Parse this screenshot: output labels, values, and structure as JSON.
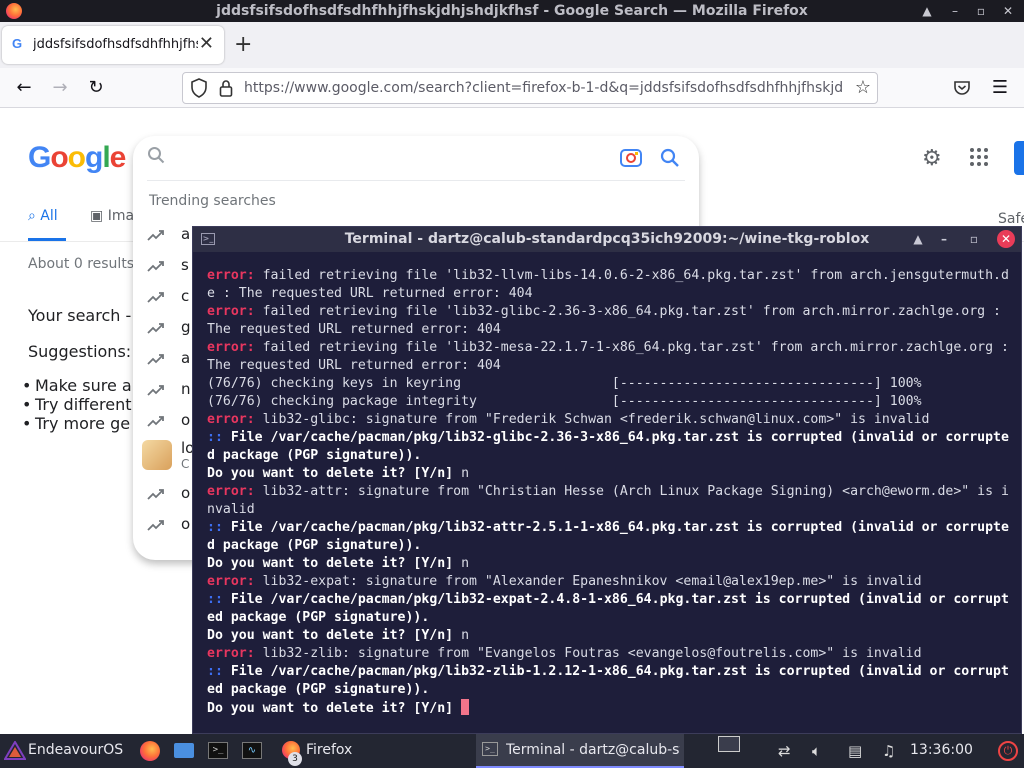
{
  "firefox": {
    "window_title": "jddsfsifsdofhsdfsdhfhhjfhskjdhjshdjkfhsf - Google Search — Mozilla Firefox",
    "tab_title": "jddsfsifsdofhsdfsdhfhhjfhskjdhjshdjkfhsf",
    "url": "https://www.google.com/search?client=firefox-b-1-d&q=jddsfsifsdofhsdfsdhfhhjfhskjdhjshdjkfhsf",
    "tab_close": "✕",
    "new_tab": "+"
  },
  "google": {
    "logo_letters": [
      "G",
      "o",
      "o",
      "g",
      "l",
      "e"
    ],
    "tabs": {
      "all": "All",
      "images": "Ima"
    },
    "safe_search": "Safe",
    "results_count": "About 0 results (0",
    "your_search": "Your search - jo",
    "suggestions_title": "Suggestions:",
    "suggestions": [
      "Make sure a",
      "Try different",
      "Try more ge"
    ],
    "dropdown": {
      "trending_label": "Trending searches",
      "items": [
        "a",
        "s",
        "c",
        "g",
        "a",
        "n",
        "o"
      ],
      "thumb_item": {
        "title": "lo",
        "subtitle": "C"
      },
      "items_after": [
        "o",
        "o"
      ]
    }
  },
  "terminal": {
    "title": "Terminal - dartz@calub-standardpcq35ich92009:~/wine-tkg-roblox",
    "lines": [
      [
        [
          "err",
          "error:"
        ],
        [
          "txt",
          " failed retrieving file 'lib32-llvm-libs-14.0.6-2-x86_64.pkg.tar.zst' from arch.jensgutermuth.de : The requested URL returned error: 404"
        ]
      ],
      [
        [
          "err",
          "error:"
        ],
        [
          "txt",
          " failed retrieving file 'lib32-glibc-2.36-3-x86_64.pkg.tar.zst' from arch.mirror.zachlge.org : The requested URL returned error: 404"
        ]
      ],
      [
        [
          "err",
          "error:"
        ],
        [
          "txt",
          " failed retrieving file 'lib32-mesa-22.1.7-1-x86_64.pkg.tar.zst' from arch.mirror.zachlge.org : The requested URL returned error: 404"
        ]
      ],
      [
        [
          "txt",
          "(76/76) checking keys in keyring                   [--------------------------------] 100%"
        ]
      ],
      [
        [
          "txt",
          "(76/76) checking package integrity                 [--------------------------------] 100%"
        ]
      ],
      [
        [
          "err",
          "error:"
        ],
        [
          "txt",
          " lib32-glibc: signature from \"Frederik Schwan <frederik.schwan@linux.com>\" is invalid"
        ]
      ],
      [
        [
          "arrow",
          ":: "
        ],
        [
          "bold",
          "File /var/cache/pacman/pkg/lib32-glibc-2.36-3-x86_64.pkg.tar.zst is corrupted (invalid or corrupted package (PGP signature))."
        ]
      ],
      [
        [
          "bold",
          "Do you want to delete it? [Y/n]"
        ],
        [
          "txt",
          " n"
        ]
      ],
      [
        [
          "err",
          "error:"
        ],
        [
          "txt",
          " lib32-attr: signature from \"Christian Hesse (Arch Linux Package Signing) <arch@eworm.de>\" is invalid"
        ]
      ],
      [
        [
          "arrow",
          ":: "
        ],
        [
          "bold",
          "File /var/cache/pacman/pkg/lib32-attr-2.5.1-1-x86_64.pkg.tar.zst is corrupted (invalid or corrupted package (PGP signature))."
        ]
      ],
      [
        [
          "bold",
          "Do you want to delete it? [Y/n]"
        ],
        [
          "txt",
          " n"
        ]
      ],
      [
        [
          "err",
          "error:"
        ],
        [
          "txt",
          " lib32-expat: signature from \"Alexander Epaneshnikov <email@alex19ep.me>\" is invalid"
        ]
      ],
      [
        [
          "arrow",
          ":: "
        ],
        [
          "bold",
          "File /var/cache/pacman/pkg/lib32-expat-2.4.8-1-x86_64.pkg.tar.zst is corrupted (invalid or corrupted package (PGP signature))."
        ]
      ],
      [
        [
          "bold",
          "Do you want to delete it? [Y/n]"
        ],
        [
          "txt",
          " n"
        ]
      ],
      [
        [
          "err",
          "error:"
        ],
        [
          "txt",
          " lib32-zlib: signature from \"Evangelos Foutras <evangelos@foutrelis.com>\" is invalid"
        ]
      ],
      [
        [
          "arrow",
          ":: "
        ],
        [
          "bold",
          "File /var/cache/pacman/pkg/lib32-zlib-1.2.12-1-x86_64.pkg.tar.zst is corrupted (invalid or corrupted package (PGP signature))."
        ]
      ],
      [
        [
          "bold",
          "Do you want to delete it? [Y/n] "
        ]
      ]
    ]
  },
  "taskbar": {
    "start_label": "EndeavourOS",
    "firefox_task": "Firefox",
    "firefox_badge": "3",
    "terminal_task": "Terminal - dartz@calub-st...",
    "clock": "13:36:00"
  },
  "colors": {
    "google_blue": "#1a73e8",
    "terminal_bg": "#1e1e3a",
    "error_red": "#e8365f",
    "close_red": "#e93c58"
  },
  "icons": [
    "firefox-icon",
    "google-icon",
    "shield-icon",
    "lock-icon",
    "star-icon",
    "pocket-icon",
    "menu-icon",
    "gear-icon",
    "apps-icon",
    "search-icon",
    "lens-icon",
    "trending-icon",
    "terminal-icon",
    "folder-icon",
    "volume-icon",
    "clock"
  ]
}
